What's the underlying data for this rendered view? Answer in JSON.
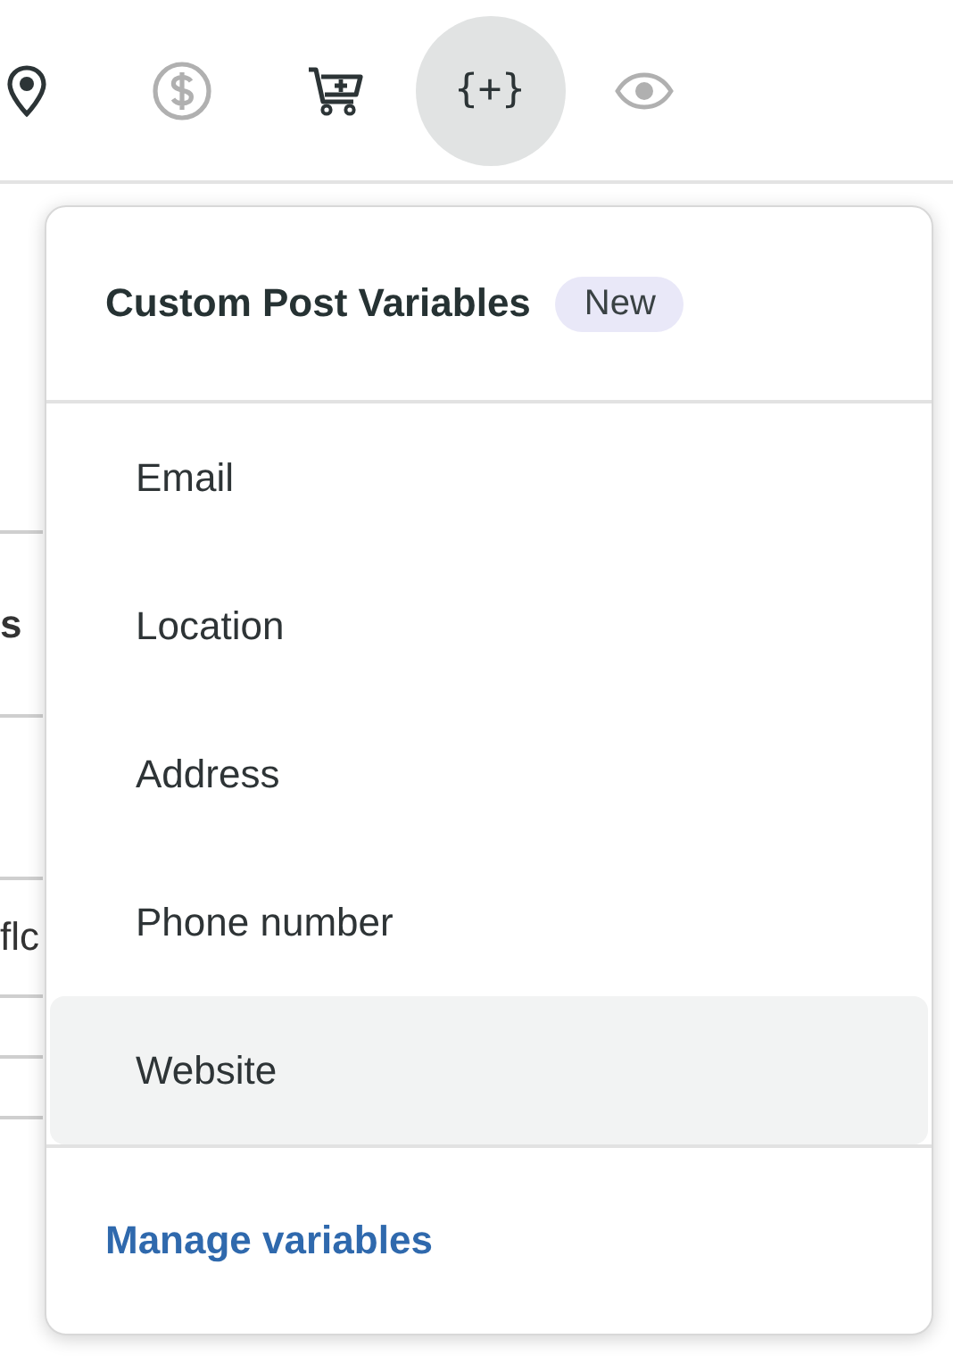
{
  "toolbar": [
    {
      "kind": "pin",
      "selected": false,
      "disabled": false
    },
    {
      "kind": "dollar",
      "selected": false,
      "disabled": true
    },
    {
      "kind": "cart",
      "selected": false,
      "disabled": false
    },
    {
      "kind": "variables",
      "label": "{+}",
      "selected": true,
      "disabled": false
    },
    {
      "kind": "eye",
      "selected": false,
      "disabled": true
    }
  ],
  "background_rows": [
    {
      "text": "s",
      "bold": true
    },
    {},
    {
      "text": "flc",
      "bold": false
    },
    {},
    {}
  ],
  "dropdown": {
    "title": "Custom Post Variables",
    "badge": "New",
    "items": [
      {
        "label": "Email",
        "selected": false
      },
      {
        "label": "Location",
        "selected": false
      },
      {
        "label": "Address",
        "selected": false
      },
      {
        "label": "Phone number",
        "selected": false
      },
      {
        "label": "Website",
        "selected": true
      }
    ],
    "footer_link": "Manage variables"
  }
}
